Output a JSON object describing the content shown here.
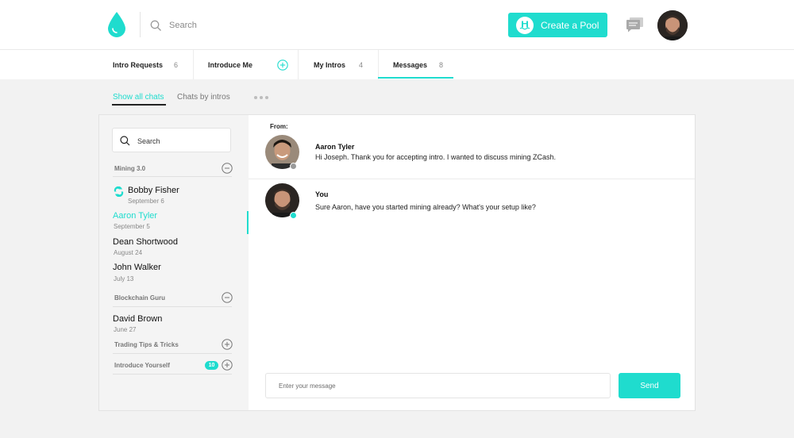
{
  "header": {
    "search_placeholder": "Search",
    "create_pool_label": "Create a Pool"
  },
  "tabs": [
    {
      "label": "Intro Requests",
      "count": "6"
    },
    {
      "label": "Introduce Me",
      "count": ""
    },
    {
      "label": "My Intros",
      "count": "4"
    },
    {
      "label": "Messages",
      "count": "8"
    }
  ],
  "subtabs": {
    "active": "Show all chats",
    "other": "Chats by intros"
  },
  "sidebar": {
    "search_placeholder": "Search",
    "groups": [
      {
        "title": "Mining 3.0",
        "toggle": "minus"
      },
      {
        "title": "Blockchain Guru",
        "toggle": "minus"
      },
      {
        "title": "Trading Tips & Tricks",
        "toggle": "plus"
      },
      {
        "title": "Introduce Yourself",
        "toggle": "plus",
        "badge": "10"
      }
    ],
    "contacts": [
      {
        "name": "Bobby Fisher",
        "date": "September 6"
      },
      {
        "name": "Aaron Tyler",
        "date": "September 5",
        "active": true
      },
      {
        "name": "Dean Shortwood",
        "date": "August 24"
      },
      {
        "name": "John Walker",
        "date": "July 13"
      },
      {
        "name": "David Brown",
        "date": "June 27"
      }
    ]
  },
  "chat": {
    "from_label": "From:",
    "messages": [
      {
        "sender": "Aaron Tyler",
        "text": "Hi Joseph. Thank you for accepting intro. I wanted to discuss mining ZCash."
      },
      {
        "sender": "You",
        "text": "Sure Aaron, have you started mining already? What's your setup like?"
      }
    ],
    "input_placeholder": "Enter your message",
    "send_label": "Send"
  },
  "colors": {
    "accent": "#1fdcce",
    "background": "#f2f2f2"
  }
}
